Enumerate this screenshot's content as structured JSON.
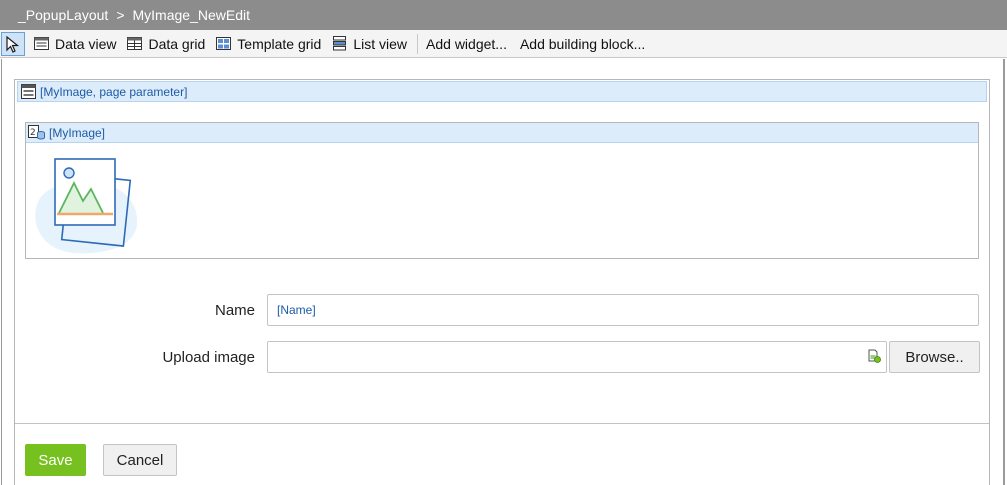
{
  "breadcrumb": {
    "parent": "_PopupLayout",
    "separator": ">",
    "current": "MyImage_NewEdit"
  },
  "toolbar": {
    "pointer_icon": "pointer-arrow-icon",
    "items": [
      {
        "label": "Data view",
        "icon": "data-view-icon"
      },
      {
        "label": "Data grid",
        "icon": "data-grid-icon"
      },
      {
        "label": "Template grid",
        "icon": "template-grid-icon"
      },
      {
        "label": "List view",
        "icon": "list-view-icon"
      }
    ],
    "add_widget": "Add widget...",
    "add_building_block": "Add building block..."
  },
  "data_view": {
    "header": "[MyImage, page parameter]"
  },
  "image_widget": {
    "header": "[MyImage]"
  },
  "form": {
    "name_label": "Name",
    "name_value": "[Name]",
    "upload_label": "Upload image",
    "upload_value": "",
    "browse_label": "Browse.."
  },
  "footer": {
    "save_label": "Save",
    "cancel_label": "Cancel"
  },
  "colors": {
    "titlebar": "#8c8c8c",
    "header_fill": "#dcecfb",
    "link_blue": "#1d5aa6",
    "save_green": "#76c11f"
  }
}
